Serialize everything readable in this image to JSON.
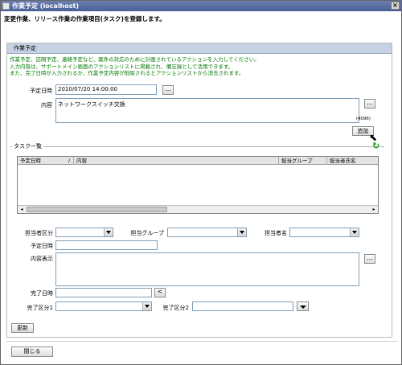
{
  "window": {
    "title": "作業予定 (localhost)",
    "close_glyph": "×"
  },
  "subtitle": "変更作業、リリース作業の作業項目(タスク)を登録します。",
  "section": {
    "title": "作業予定",
    "notice": [
      "作業予定、訪問予定、連絡予定など、案件の対応のために計画されているアクションを入力してください。",
      "入力内容は、サポートメイン画面のアクションリストに掲載され、備忘録として活用できます。",
      "また、完了日時が入力されるか、作業予定内容が削除されるとアクションリストから消去されます。"
    ]
  },
  "form": {
    "scheduled_label": "予定日時",
    "scheduled_value": "2010/07/20 14:00:00",
    "content_label": "内容",
    "content_value": "ネットワークスイッチ交換",
    "char_limit": "(4096)",
    "ellipsis": "...",
    "add_label": "追加"
  },
  "task_list": {
    "legend": "タスク一覧",
    "columns": [
      "予定日時",
      "/",
      "内容",
      "担当グループ",
      "担当者氏名"
    ],
    "scroll_left": "◂",
    "scroll_right": "▸"
  },
  "detail": {
    "assignee_type_label": "担当者区分",
    "group_label": "担当グループ",
    "assignee_label": "担当者名",
    "scheduled_label": "予定日時",
    "content_label": "内容表示",
    "done_label": "完了日時",
    "done_type1_label": "完了区分1",
    "done_type2_label": "完了区分2",
    "clear_glyph": "<",
    "ellipsis": "...",
    "update_label": "更新"
  },
  "footer": {
    "close_label": "閉じる"
  },
  "icons": {
    "refresh": "↻",
    "cursor": "⬉"
  }
}
